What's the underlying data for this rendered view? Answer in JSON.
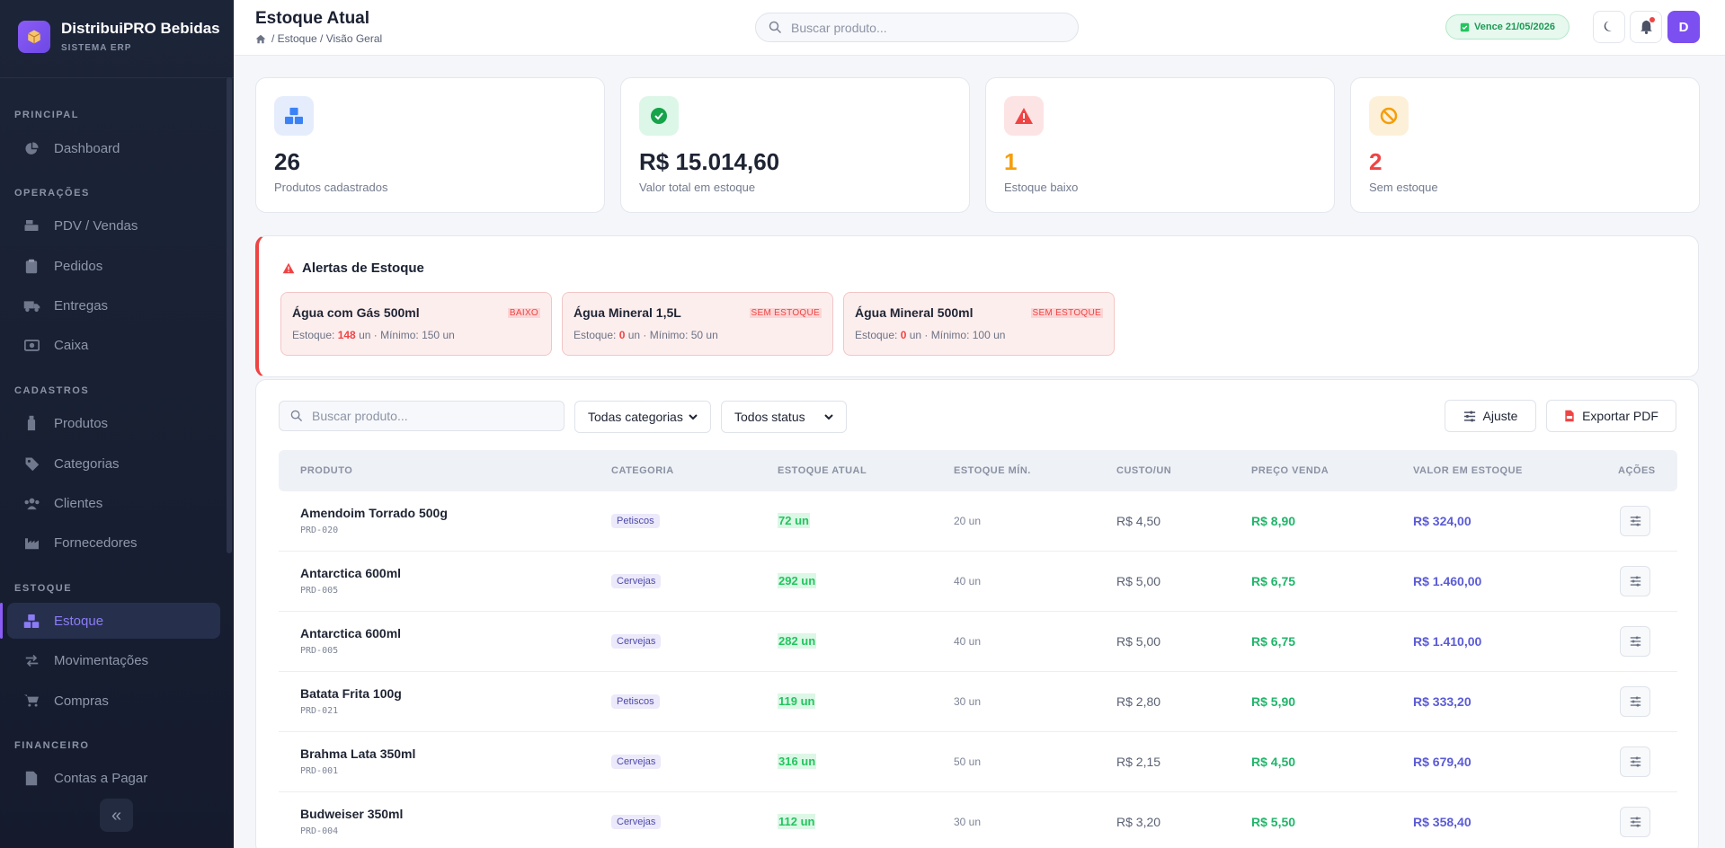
{
  "brand": {
    "name": "DistribuiPRO Bebidas",
    "subtitle": "SISTEMA ERP",
    "logo_icon": "box-icon"
  },
  "sidebar": {
    "sections": [
      {
        "label": "PRINCIPAL",
        "items": [
          {
            "label": "Dashboard",
            "icon": "chart-pie-icon"
          }
        ]
      },
      {
        "label": "OPERAÇÕES",
        "items": [
          {
            "label": "PDV / Vendas",
            "icon": "cash-register-icon"
          },
          {
            "label": "Pedidos",
            "icon": "clipboard-icon"
          },
          {
            "label": "Entregas",
            "icon": "truck-icon"
          },
          {
            "label": "Caixa",
            "icon": "money-icon"
          }
        ]
      },
      {
        "label": "CADASTROS",
        "items": [
          {
            "label": "Produtos",
            "icon": "bottle-icon"
          },
          {
            "label": "Categorias",
            "icon": "tag-icon"
          },
          {
            "label": "Clientes",
            "icon": "users-icon"
          },
          {
            "label": "Fornecedores",
            "icon": "industry-icon"
          }
        ]
      },
      {
        "label": "ESTOQUE",
        "items": [
          {
            "label": "Estoque",
            "icon": "boxes-icon",
            "active": true
          },
          {
            "label": "Movimentações",
            "icon": "arrows-swap-icon"
          },
          {
            "label": "Compras",
            "icon": "cart-icon"
          }
        ]
      },
      {
        "label": "FINANCEIRO",
        "items": [
          {
            "label": "Contas a Pagar",
            "icon": "file-invoice-icon"
          }
        ]
      }
    ],
    "collapse_glyph": "«"
  },
  "header": {
    "title": "Estoque Atual",
    "breadcrumb": "/ Estoque / Visão Geral",
    "search_placeholder": "Buscar produto...",
    "license_badge": "Vence 21/05/2026",
    "avatar_initial": "D"
  },
  "stats": [
    {
      "value": "26",
      "label": "Produtos cadastrados",
      "icon": "boxes-icon",
      "color": "#1e2433",
      "bg": "#e5edfd",
      "icon_color": "#3b82f6"
    },
    {
      "value": "R$ 15.014,60",
      "label": "Valor total em estoque",
      "icon": "check-circle-icon",
      "color": "#1e2433",
      "bg": "#dcf7e8",
      "icon_color": "#16a34a"
    },
    {
      "value": "1",
      "label": "Estoque baixo",
      "icon": "warning-icon",
      "color": "#f59e0b",
      "bg": "#fde4e4",
      "icon_color": "#ef4444"
    },
    {
      "value": "2",
      "label": "Sem estoque",
      "icon": "ban-icon",
      "color": "#ef4444",
      "bg": "#fdf0d9",
      "icon_color": "#f59e0b"
    }
  ],
  "alerts": {
    "title": "Alertas de Estoque",
    "items": [
      {
        "name": "Água com Gás 500ml",
        "tag": "BAIXO",
        "prefix": "Estoque: ",
        "qty": "148",
        "suffix": " un · Mínimo: 150 un"
      },
      {
        "name": "Água Mineral 1,5L",
        "tag": "SEM ESTOQUE",
        "prefix": "Estoque: ",
        "qty": "0",
        "suffix": " un · Mínimo: 50 un"
      },
      {
        "name": "Água Mineral 500ml",
        "tag": "SEM ESTOQUE",
        "prefix": "Estoque: ",
        "qty": "0",
        "suffix": " un · Mínimo: 100 un"
      }
    ]
  },
  "filters": {
    "search_placeholder": "Buscar produto...",
    "category_selected": "Todas categorias",
    "status_selected": "Todos status",
    "adjust_label": "Ajuste",
    "export_label": "Exportar PDF"
  },
  "table": {
    "columns": [
      "PRODUTO",
      "CATEGORIA",
      "ESTOQUE ATUAL",
      "ESTOQUE MÍN.",
      "CUSTO/UN",
      "PREÇO VENDA",
      "VALOR EM ESTOQUE",
      "AÇÕES"
    ],
    "rows": [
      {
        "name": "Amendoim Torrado 500g",
        "code": "PRD-020",
        "category": "Petiscos",
        "stock": "72 un",
        "min": "20 un",
        "cost": "R$ 4,50",
        "price": "R$ 8,90",
        "value": "R$ 324,00"
      },
      {
        "name": "Antarctica 600ml",
        "code": "PRD-005",
        "category": "Cervejas",
        "stock": "292 un",
        "min": "40 un",
        "cost": "R$ 5,00",
        "price": "R$ 6,75",
        "value": "R$ 1.460,00"
      },
      {
        "name": "Antarctica 600ml",
        "code": "PRD-005",
        "category": "Cervejas",
        "stock": "282 un",
        "min": "40 un",
        "cost": "R$ 5,00",
        "price": "R$ 6,75",
        "value": "R$ 1.410,00"
      },
      {
        "name": "Batata Frita 100g",
        "code": "PRD-021",
        "category": "Petiscos",
        "stock": "119 un",
        "min": "30 un",
        "cost": "R$ 2,80",
        "price": "R$ 5,90",
        "value": "R$ 333,20"
      },
      {
        "name": "Brahma Lata 350ml",
        "code": "PRD-001",
        "category": "Cervejas",
        "stock": "316 un",
        "min": "50 un",
        "cost": "R$ 2,15",
        "price": "R$ 4,50",
        "value": "R$ 679,40"
      },
      {
        "name": "Budweiser 350ml",
        "code": "PRD-004",
        "category": "Cervejas",
        "stock": "112 un",
        "min": "30 un",
        "cost": "R$ 3,20",
        "price": "R$ 5,50",
        "value": "R$ 358,40"
      }
    ]
  },
  "colors": {
    "accent": "#8b5cf6",
    "danger": "#ef4444",
    "success": "#22c55e",
    "value": "#5b5bd6"
  }
}
